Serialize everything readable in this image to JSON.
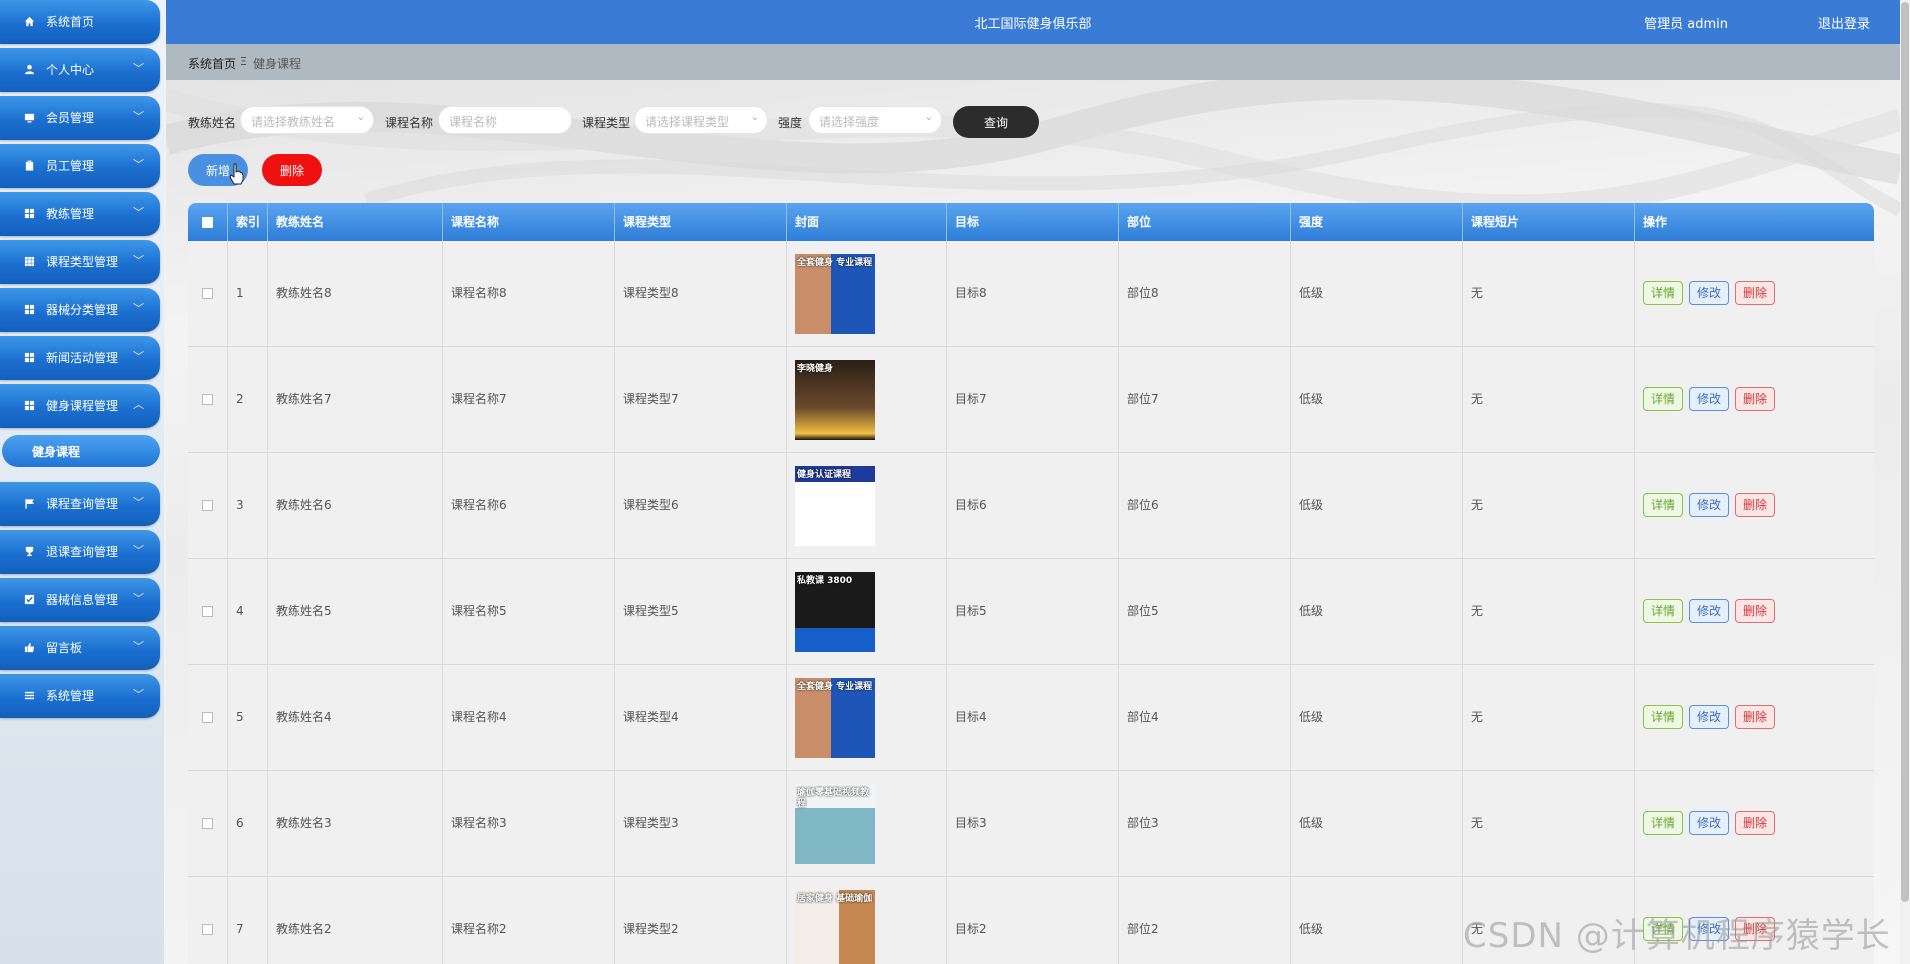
{
  "colors": {
    "header": "#3a7bd5",
    "menu": "#1c6fcf",
    "add_button": "#4a90e2",
    "delete_button": "#f01010",
    "query_button": "#2c2c2c"
  },
  "sidebar": {
    "items": [
      {
        "label": "系统首页",
        "icon": "home-icon",
        "expandable": false
      },
      {
        "label": "个人中心",
        "icon": "user-icon",
        "expandable": true
      },
      {
        "label": "会员管理",
        "icon": "monitor-icon",
        "expandable": true
      },
      {
        "label": "员工管理",
        "icon": "clipboard-icon",
        "expandable": true
      },
      {
        "label": "教练管理",
        "icon": "grid-icon",
        "expandable": true
      },
      {
        "label": "课程类型管理",
        "icon": "apps-icon",
        "expandable": true
      },
      {
        "label": "器械分类管理",
        "icon": "grid-icon",
        "expandable": true
      },
      {
        "label": "新闻活动管理",
        "icon": "grid-icon",
        "expandable": true
      },
      {
        "label": "健身课程管理",
        "icon": "grid-icon",
        "expandable": true,
        "expanded": true
      },
      {
        "label": "课程查询管理",
        "icon": "flag-icon",
        "expandable": true
      },
      {
        "label": "退课查询管理",
        "icon": "trophy-icon",
        "expandable": true
      },
      {
        "label": "器械信息管理",
        "icon": "check-square-icon",
        "expandable": true
      },
      {
        "label": "留言板",
        "icon": "thumbs-up-icon",
        "expandable": true
      },
      {
        "label": "系统管理",
        "icon": "list-icon",
        "expandable": true
      }
    ],
    "active_sub": "健身课程"
  },
  "header": {
    "title": "北工国际健身俱乐部",
    "admin_label": "管理员 admin",
    "logout_label": "退出登录"
  },
  "breadcrumb": {
    "home": "系统首页",
    "separator": "Ξ",
    "current": "健身课程"
  },
  "search": {
    "coach_label": "教练姓名",
    "coach_placeholder": "请选择教练姓名",
    "course_label": "课程名称",
    "course_placeholder": "课程名称",
    "type_label": "课程类型",
    "type_placeholder": "请选择课程类型",
    "intensity_label": "强度",
    "intensity_placeholder": "请选择强度",
    "query_label": "查询"
  },
  "actions": {
    "add_label": "新增",
    "delete_label": "删除"
  },
  "table": {
    "columns": [
      "索引",
      "教练姓名",
      "课程名称",
      "课程类型",
      "封面",
      "目标",
      "部位",
      "强度",
      "课程短片",
      "操作"
    ],
    "op_labels": {
      "detail": "详情",
      "edit": "修改",
      "delete": "删除"
    },
    "rows": [
      {
        "index": "1",
        "coach": "教练姓名8",
        "course": "课程名称8",
        "type": "课程类型8",
        "cover": "全套健身 专业课程",
        "target": "目标8",
        "part": "部位8",
        "intensity": "低级",
        "video": "无"
      },
      {
        "index": "2",
        "coach": "教练姓名7",
        "course": "课程名称7",
        "type": "课程类型7",
        "cover": "李晓健身",
        "target": "目标7",
        "part": "部位7",
        "intensity": "低级",
        "video": "无"
      },
      {
        "index": "3",
        "coach": "教练姓名6",
        "course": "课程名称6",
        "type": "课程类型6",
        "cover": "健身认证课程",
        "target": "目标6",
        "part": "部位6",
        "intensity": "低级",
        "video": "无"
      },
      {
        "index": "4",
        "coach": "教练姓名5",
        "course": "课程名称5",
        "type": "课程类型5",
        "cover": "私教课 3800",
        "target": "目标5",
        "part": "部位5",
        "intensity": "低级",
        "video": "无"
      },
      {
        "index": "5",
        "coach": "教练姓名4",
        "course": "课程名称4",
        "type": "课程类型4",
        "cover": "全套健身 专业课程",
        "target": "目标4",
        "part": "部位4",
        "intensity": "低级",
        "video": "无"
      },
      {
        "index": "6",
        "coach": "教练姓名3",
        "course": "课程名称3",
        "type": "课程类型3",
        "cover": "瑜伽零基础视频教程",
        "target": "目标3",
        "part": "部位3",
        "intensity": "低级",
        "video": "无"
      },
      {
        "index": "7",
        "coach": "教练姓名2",
        "course": "课程名称2",
        "type": "课程类型2",
        "cover": "居家健身 基础瑜伽",
        "target": "目标2",
        "part": "部位2",
        "intensity": "低级",
        "video": "无"
      }
    ]
  },
  "watermark": "CSDN @计算机程序猿学长"
}
